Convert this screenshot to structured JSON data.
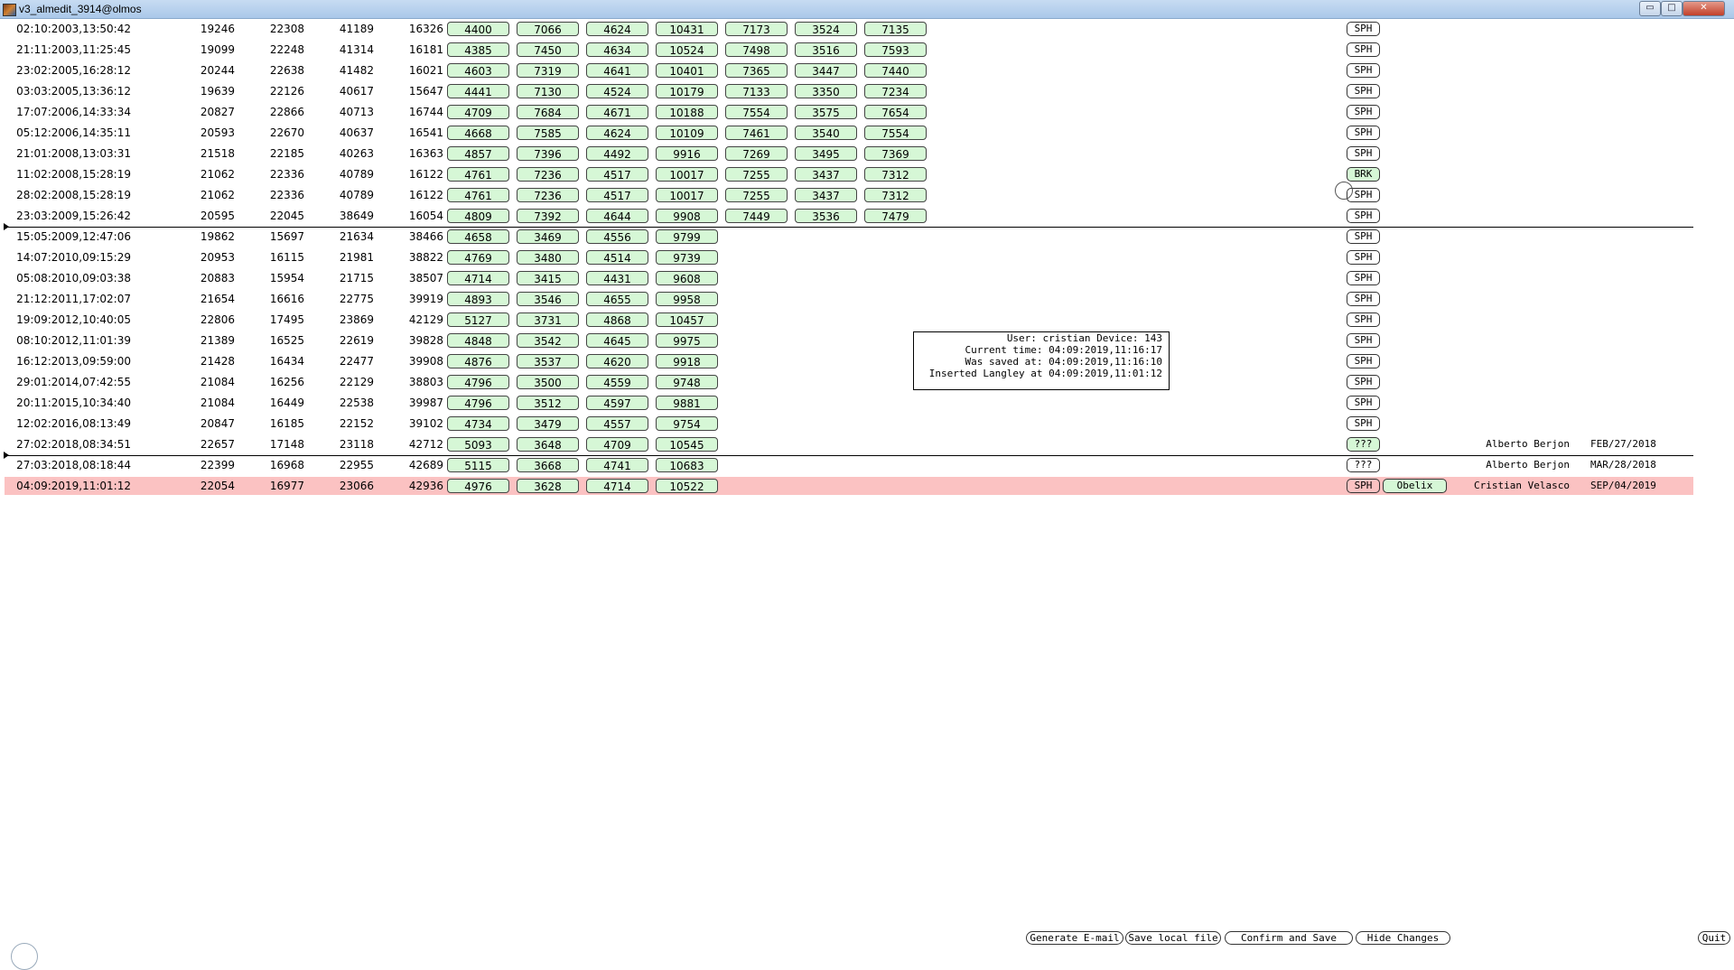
{
  "window": {
    "title": "v3_almedit_3914@olmos",
    "minimize": "▭",
    "maximize": "□",
    "close": "✕"
  },
  "rows": [
    {
      "date": "02:10:2003,13:50:42",
      "a": "19246",
      "b": "22308",
      "c": "41189",
      "d": "16326",
      "boxes": [
        "4400",
        "7066",
        "4624",
        "10431",
        "7173",
        "3524",
        "7135"
      ],
      "flag": "SPH",
      "flag_style": "plain"
    },
    {
      "date": "21:11:2003,11:25:45",
      "a": "19099",
      "b": "22248",
      "c": "41314",
      "d": "16181",
      "boxes": [
        "4385",
        "7450",
        "4634",
        "10524",
        "7498",
        "3516",
        "7593"
      ],
      "flag": "SPH",
      "flag_style": "plain"
    },
    {
      "date": "23:02:2005,16:28:12",
      "a": "20244",
      "b": "22638",
      "c": "41482",
      "d": "16021",
      "boxes": [
        "4603",
        "7319",
        "4641",
        "10401",
        "7365",
        "3447",
        "7440"
      ],
      "flag": "SPH",
      "flag_style": "plain"
    },
    {
      "date": "03:03:2005,13:36:12",
      "a": "19639",
      "b": "22126",
      "c": "40617",
      "d": "15647",
      "boxes": [
        "4441",
        "7130",
        "4524",
        "10179",
        "7133",
        "3350",
        "7234"
      ],
      "flag": "SPH",
      "flag_style": "plain"
    },
    {
      "date": "17:07:2006,14:33:34",
      "a": "20827",
      "b": "22866",
      "c": "40713",
      "d": "16744",
      "boxes": [
        "4709",
        "7684",
        "4671",
        "10188",
        "7554",
        "3575",
        "7654"
      ],
      "flag": "SPH",
      "flag_style": "plain"
    },
    {
      "date": "05:12:2006,14:35:11",
      "a": "20593",
      "b": "22670",
      "c": "40637",
      "d": "16541",
      "boxes": [
        "4668",
        "7585",
        "4624",
        "10109",
        "7461",
        "3540",
        "7554"
      ],
      "flag": "SPH",
      "flag_style": "plain"
    },
    {
      "date": "21:01:2008,13:03:31",
      "a": "21518",
      "b": "22185",
      "c": "40263",
      "d": "16363",
      "boxes": [
        "4857",
        "7396",
        "4492",
        "9916",
        "7269",
        "3495",
        "7369"
      ],
      "flag": "SPH",
      "flag_style": "plain"
    },
    {
      "date": "11:02:2008,15:28:19",
      "a": "21062",
      "b": "22336",
      "c": "40789",
      "d": "16122",
      "boxes": [
        "4761",
        "7236",
        "4517",
        "10017",
        "7255",
        "3437",
        "7312"
      ],
      "flag": "BRK",
      "flag_style": "green"
    },
    {
      "date": "28:02:2008,15:28:19",
      "a": "21062",
      "b": "22336",
      "c": "40789",
      "d": "16122",
      "boxes": [
        "4761",
        "7236",
        "4517",
        "10017",
        "7255",
        "3437",
        "7312"
      ],
      "flag": "SPH",
      "flag_style": "plain"
    },
    {
      "date": "23:03:2009,15:26:42",
      "a": "20595",
      "b": "22045",
      "c": "38649",
      "d": "16054",
      "boxes": [
        "4809",
        "7392",
        "4644",
        "9908",
        "7449",
        "3536",
        "7479"
      ],
      "flag": "SPH",
      "flag_style": "plain"
    },
    {
      "date": "15:05:2009,12:47:06",
      "a": "19862",
      "b": "15697",
      "c": "21634",
      "d": "38466",
      "boxes": [
        "4658",
        "3469",
        "4556",
        "9799"
      ],
      "flag": "SPH",
      "flag_style": "plain"
    },
    {
      "date": "14:07:2010,09:15:29",
      "a": "20953",
      "b": "16115",
      "c": "21981",
      "d": "38822",
      "boxes": [
        "4769",
        "3480",
        "4514",
        "9739"
      ],
      "flag": "SPH",
      "flag_style": "plain"
    },
    {
      "date": "05:08:2010,09:03:38",
      "a": "20883",
      "b": "15954",
      "c": "21715",
      "d": "38507",
      "boxes": [
        "4714",
        "3415",
        "4431",
        "9608"
      ],
      "flag": "SPH",
      "flag_style": "plain"
    },
    {
      "date": "21:12:2011,17:02:07",
      "a": "21654",
      "b": "16616",
      "c": "22775",
      "d": "39919",
      "boxes": [
        "4893",
        "3546",
        "4655",
        "9958"
      ],
      "flag": "SPH",
      "flag_style": "plain"
    },
    {
      "date": "19:09:2012,10:40:05",
      "a": "22806",
      "b": "17495",
      "c": "23869",
      "d": "42129",
      "boxes": [
        "5127",
        "3731",
        "4868",
        "10457"
      ],
      "flag": "SPH",
      "flag_style": "plain"
    },
    {
      "date": "08:10:2012,11:01:39",
      "a": "21389",
      "b": "16525",
      "c": "22619",
      "d": "39828",
      "boxes": [
        "4848",
        "3542",
        "4645",
        "9975"
      ],
      "flag": "SPH",
      "flag_style": "plain"
    },
    {
      "date": "16:12:2013,09:59:00",
      "a": "21428",
      "b": "16434",
      "c": "22477",
      "d": "39908",
      "boxes": [
        "4876",
        "3537",
        "4620",
        "9918"
      ],
      "flag": "SPH",
      "flag_style": "plain"
    },
    {
      "date": "29:01:2014,07:42:55",
      "a": "21084",
      "b": "16256",
      "c": "22129",
      "d": "38803",
      "boxes": [
        "4796",
        "3500",
        "4559",
        "9748"
      ],
      "flag": "SPH",
      "flag_style": "plain"
    },
    {
      "date": "20:11:2015,10:34:40",
      "a": "21084",
      "b": "16449",
      "c": "22538",
      "d": "39987",
      "boxes": [
        "4796",
        "3512",
        "4597",
        "9881"
      ],
      "flag": "SPH",
      "flag_style": "plain"
    },
    {
      "date": "12:02:2016,08:13:49",
      "a": "20847",
      "b": "16185",
      "c": "22152",
      "d": "39102",
      "boxes": [
        "4734",
        "3479",
        "4557",
        "9754"
      ],
      "flag": "SPH",
      "flag_style": "plain"
    },
    {
      "date": "27:02:2018,08:34:51",
      "a": "22657",
      "b": "17148",
      "c": "23118",
      "d": "42712",
      "boxes": [
        "5093",
        "3648",
        "4709",
        "10545"
      ],
      "flag": "???",
      "flag_style": "green",
      "person": "Alberto Berjon",
      "pdate": "FEB/27/2018"
    },
    {
      "date": "27:03:2018,08:18:44",
      "a": "22399",
      "b": "16968",
      "c": "22955",
      "d": "42689",
      "boxes": [
        "5115",
        "3668",
        "4741",
        "10683"
      ],
      "flag": "???",
      "flag_style": "plain",
      "person": "Alberto Berjon",
      "pdate": "MAR/28/2018"
    },
    {
      "date": "04:09:2019,11:01:12",
      "a": "22054",
      "b": "16977",
      "c": "23066",
      "d": "42936",
      "boxes": [
        "4976",
        "3628",
        "4714",
        "10522"
      ],
      "flag": "SPH",
      "flag_style": "pink",
      "obelix": "Obelix",
      "person": "Cristian Velasco",
      "pdate": "SEP/04/2019",
      "highlight": true
    }
  ],
  "info": {
    "line1": "User: cristian Device: 143",
    "line2": "Current time: 04:09:2019,11:16:17",
    "line3": "Was saved at: 04:09:2019,11:16:10",
    "line4": "Inserted Langley at 04:09:2019,11:01:12"
  },
  "buttons": {
    "generate_email": "Generate E-mail",
    "save_local": "Save local file",
    "confirm_save": "Confirm and Save",
    "hide_changes": "Hide Changes",
    "quit": "Quit"
  }
}
